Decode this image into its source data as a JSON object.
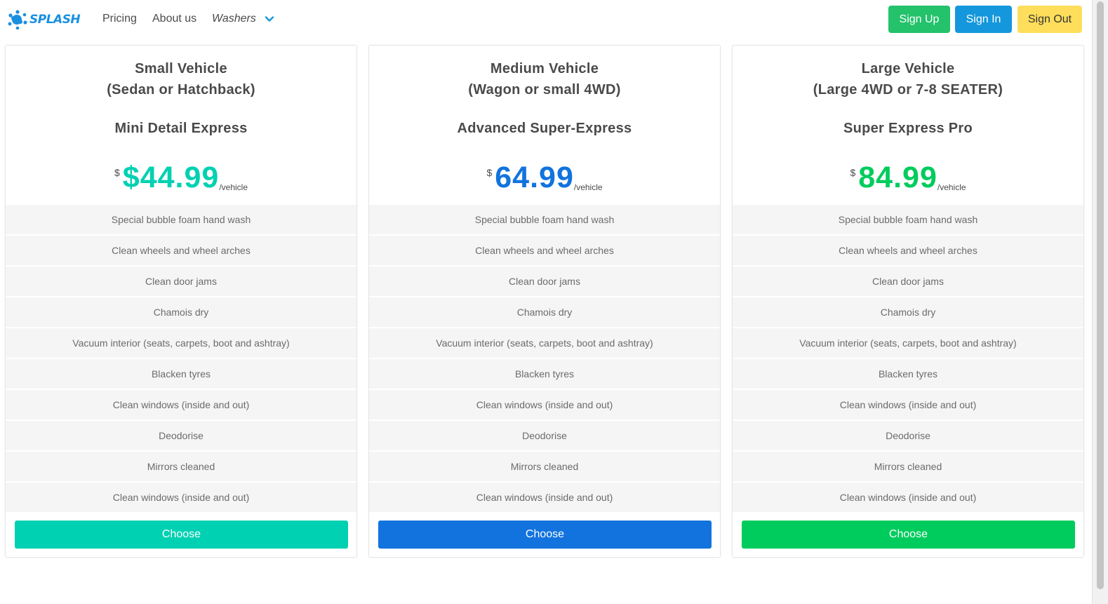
{
  "brand": {
    "logo_text": "SPLASH",
    "logo_color": "#1a8fe0"
  },
  "nav": {
    "pricing": "Pricing",
    "about": "About us",
    "washers": "Washers"
  },
  "auth": {
    "sign_up": "Sign Up",
    "sign_in": "Sign In",
    "sign_out": "Sign Out",
    "sign_up_color": "#23c26b",
    "sign_in_color": "#1497dc",
    "sign_out_color": "#fede5b"
  },
  "plans": [
    {
      "vehicle": "Small Vehicle",
      "vehicle_sub": "(Sedan or Hatchback)",
      "name": "Mini Detail Express",
      "currency": "$",
      "price": "$44.99",
      "per": "/vehicle",
      "accent": "#00d1b2",
      "features": [
        "Special bubble foam hand wash",
        "Clean wheels and wheel arches",
        "Clean door jams",
        "Chamois dry",
        "Vacuum interior (seats, carpets, boot and ashtray)",
        "Blacken tyres",
        "Clean windows (inside and out)",
        "Deodorise",
        "Mirrors cleaned",
        "Clean windows (inside and out)"
      ],
      "button": "Choose"
    },
    {
      "vehicle": "Medium Vehicle",
      "vehicle_sub": "(Wagon or small 4WD)",
      "name": "Advanced Super-Express",
      "currency": "$",
      "price": "64.99",
      "per": "/vehicle",
      "accent": "#1273de",
      "features": [
        "Special bubble foam hand wash",
        "Clean wheels and wheel arches",
        "Clean door jams",
        "Chamois dry",
        "Vacuum interior (seats, carpets, boot and ashtray)",
        "Blacken tyres",
        "Clean windows (inside and out)",
        "Deodorise",
        "Mirrors cleaned",
        "Clean windows (inside and out)"
      ],
      "button": "Choose"
    },
    {
      "vehicle": "Large Vehicle",
      "vehicle_sub": "(Large 4WD or 7-8 SEATER)",
      "name": "Super Express Pro",
      "currency": "$",
      "price": "84.99",
      "per": "/vehicle",
      "accent": "#00cc5d",
      "features": [
        "Special bubble foam hand wash",
        "Clean wheels and wheel arches",
        "Clean door jams",
        "Chamois dry",
        "Vacuum interior (seats, carpets, boot and ashtray)",
        "Blacken tyres",
        "Clean windows (inside and out)",
        "Deodorise",
        "Mirrors cleaned",
        "Clean windows (inside and out)"
      ],
      "button": "Choose"
    }
  ]
}
